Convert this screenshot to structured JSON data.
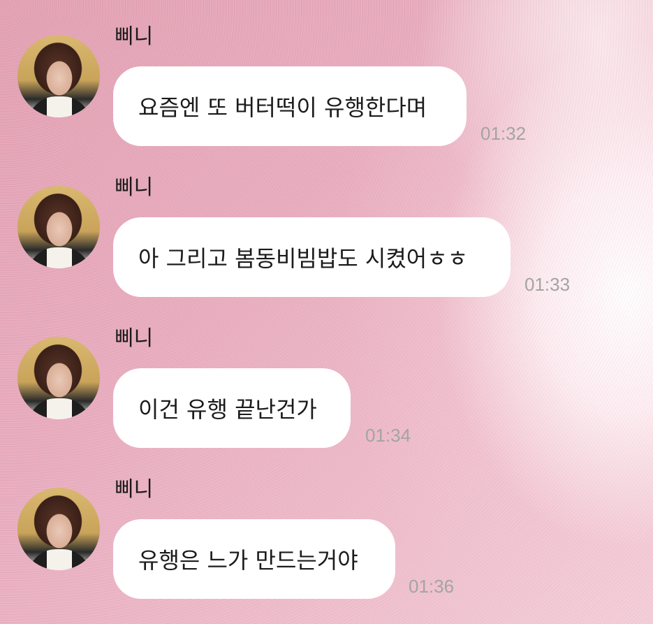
{
  "chat": {
    "messages": [
      {
        "sender": "삐니",
        "text": "요즘엔 또 버터떡이 유행한다며",
        "time": "01:32"
      },
      {
        "sender": "삐니",
        "text": "아 그리고 봄동비빔밥도 시켰어ㅎㅎ",
        "time": "01:33"
      },
      {
        "sender": "삐니",
        "text": "이건 유행 끝난건가",
        "time": "01:34"
      },
      {
        "sender": "삐니",
        "text": "유행은 느가 만드는거야",
        "time": "01:36"
      }
    ]
  }
}
